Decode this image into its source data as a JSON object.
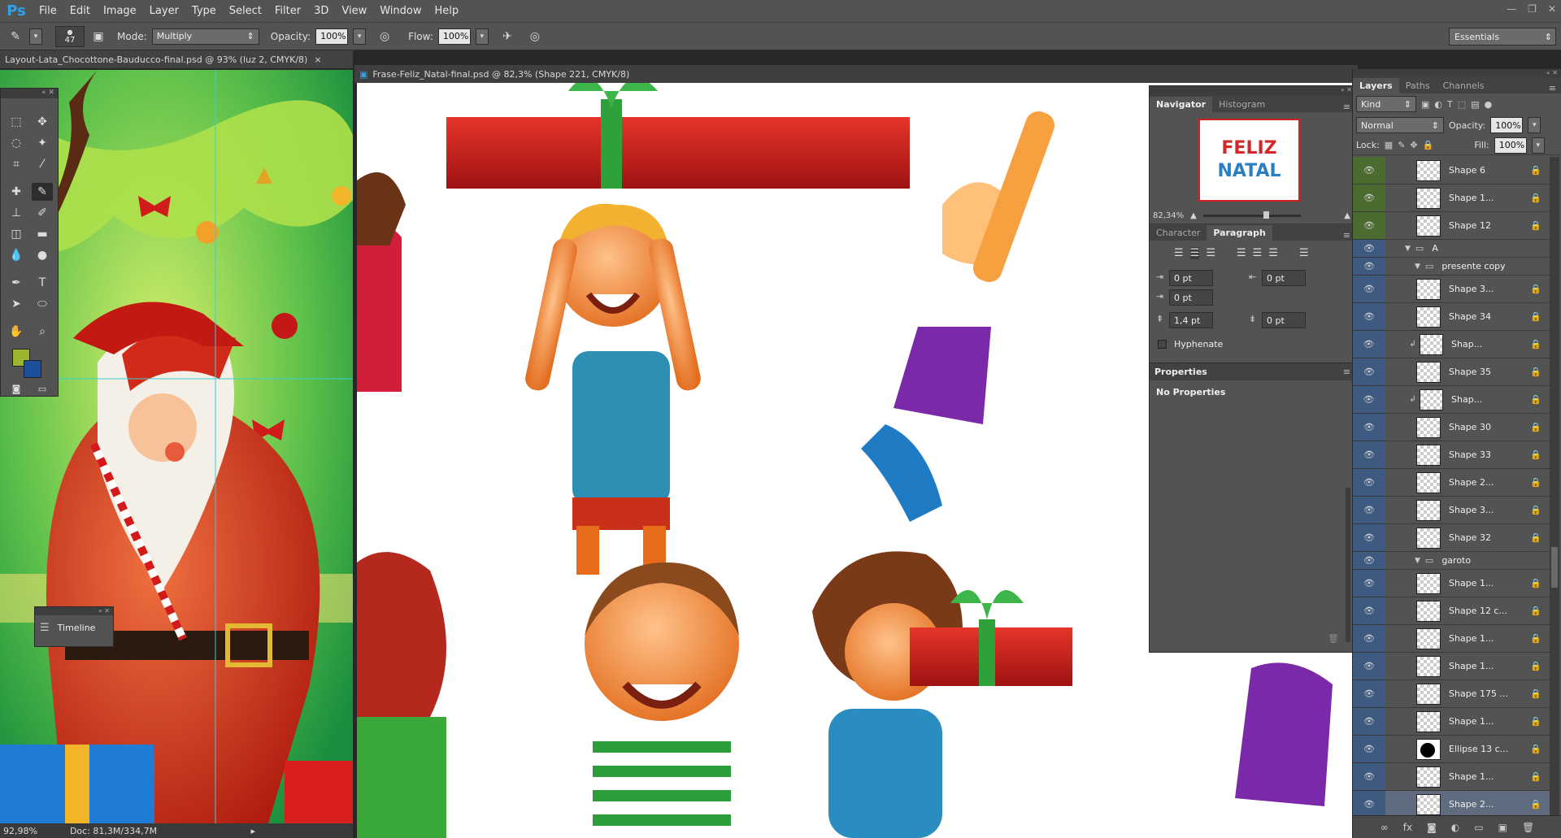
{
  "app": {
    "logo": "Ps"
  },
  "menu": [
    "File",
    "Edit",
    "Image",
    "Layer",
    "Type",
    "Select",
    "Filter",
    "3D",
    "View",
    "Window",
    "Help"
  ],
  "window_controls": [
    "—",
    "❐",
    "✕"
  ],
  "options": {
    "brush_size": "47",
    "mode_label": "Mode:",
    "mode_value": "Multiply",
    "opacity_label": "Opacity:",
    "opacity_value": "100%",
    "flow_label": "Flow:",
    "flow_value": "100%",
    "workspace": "Essentials"
  },
  "docs": [
    {
      "title": "Layout-Lata_Chocottone-Bauducco-final.psd @ 93% (luz 2, CMYK/8)",
      "close": "×"
    },
    {
      "title": "Frase-Feliz_Natal-final.psd @ 82,3% (Shape 221, CMYK/8)"
    }
  ],
  "status": {
    "zoom": "92,98%",
    "doc": "Doc: 81,3M/334,7M"
  },
  "timeline": {
    "label": "Timeline"
  },
  "navigator": {
    "tabs": [
      "Navigator",
      "Histogram"
    ],
    "zoom": "82,34%",
    "thumb_text_1": "FELIZ",
    "thumb_text_2": "NATAL"
  },
  "paragraph": {
    "tabs": [
      "Character",
      "Paragraph"
    ],
    "indent_left": "0 pt",
    "indent_right": "0 pt",
    "indent_first": "0 pt",
    "space_before": "1,4 pt",
    "space_after": "0 pt",
    "hyphenate": "Hyphenate"
  },
  "properties": {
    "title": "Properties",
    "empty": "No Properties"
  },
  "layers_panel": {
    "tabs": [
      "Layers",
      "Paths",
      "Channels"
    ],
    "kind": "Kind",
    "blend": "Normal",
    "opacity_label": "Opacity:",
    "opacity": "100%",
    "lock_label": "Lock:",
    "fill_label": "Fill:",
    "fill": "100%",
    "rows": [
      {
        "name": "Shape 6",
        "type": "layer"
      },
      {
        "name": "Shape 1...",
        "type": "layer"
      },
      {
        "name": "Shape 12",
        "type": "layer"
      },
      {
        "name": "A",
        "type": "group"
      },
      {
        "name": "presente copy",
        "type": "group"
      },
      {
        "name": "Shape 3...",
        "type": "layer"
      },
      {
        "name": "Shape 34",
        "type": "layer"
      },
      {
        "name": "Shap...",
        "type": "clip"
      },
      {
        "name": "Shape 35",
        "type": "layer"
      },
      {
        "name": "Shap...",
        "type": "clip"
      },
      {
        "name": "Shape 30",
        "type": "layer"
      },
      {
        "name": "Shape 33",
        "type": "layer"
      },
      {
        "name": "Shape 2...",
        "type": "layer"
      },
      {
        "name": "Shape 3...",
        "type": "layer"
      },
      {
        "name": "Shape 32",
        "type": "layer"
      },
      {
        "name": "garoto",
        "type": "group"
      },
      {
        "name": "Shape 1...",
        "type": "layer"
      },
      {
        "name": "Shape 12 c...",
        "type": "layer"
      },
      {
        "name": "Shape 1...",
        "type": "layer"
      },
      {
        "name": "Shape 1...",
        "type": "layer"
      },
      {
        "name": "Shape 175 ...",
        "type": "layer"
      },
      {
        "name": "Shape 1...",
        "type": "layer"
      },
      {
        "name": "Ellipse 13 c...",
        "type": "layer"
      },
      {
        "name": "Shape 1...",
        "type": "layer"
      },
      {
        "name": "Shape 2...",
        "type": "layer"
      }
    ]
  }
}
